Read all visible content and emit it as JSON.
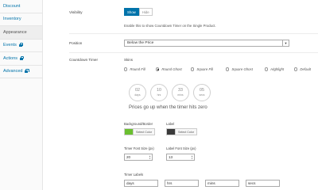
{
  "sidebar": {
    "items": [
      {
        "label": "Discount",
        "locked": false
      },
      {
        "label": "Inventory",
        "locked": false
      },
      {
        "label": "Appearance",
        "locked": false,
        "active": true
      },
      {
        "label": "Events",
        "locked": true
      },
      {
        "label": "Actions",
        "locked": true
      },
      {
        "label": "Advanced",
        "locked": true
      }
    ]
  },
  "visibility": {
    "label": "Visibility",
    "show_label": "Show",
    "hide_label": "Hide",
    "selected": "Show",
    "help_text": "Enable this to show Countdown Timer on the Single Product."
  },
  "position": {
    "label": "Position",
    "selected": "Below the Price"
  },
  "countdown": {
    "label": "Countdown Timer",
    "skins_label": "Skins",
    "skins": [
      {
        "label": "Round Fill",
        "checked": false
      },
      {
        "label": "Round Ghost",
        "checked": true
      },
      {
        "label": "Square Fill",
        "checked": false
      },
      {
        "label": "Square Ghost",
        "checked": false
      },
      {
        "label": "Highlight",
        "checked": false
      },
      {
        "label": "Default",
        "checked": false
      }
    ],
    "preview": [
      {
        "num": "02",
        "unit": "days"
      },
      {
        "num": "10",
        "unit": "hrs"
      },
      {
        "num": "33",
        "unit": "mins"
      },
      {
        "num": "05",
        "unit": "secs"
      }
    ],
    "preview_note": "Prices go up when the timer hits zero",
    "bg_border_label": "Background/Border",
    "bg_color": "#6abf2f",
    "label_label": "Label",
    "label_color": "#3a3a3a",
    "select_color_label": "Select Color",
    "timer_font_size_label": "Timer Font Size (px)",
    "timer_font_size": "20",
    "label_font_size_label": "Label Font Size (px)",
    "label_font_size": "13",
    "timer_labels_label": "Timer Labels",
    "timer_labels": [
      "days",
      "hrs",
      "mins",
      "secs"
    ]
  },
  "colors": {
    "accent": "#0073aa"
  }
}
